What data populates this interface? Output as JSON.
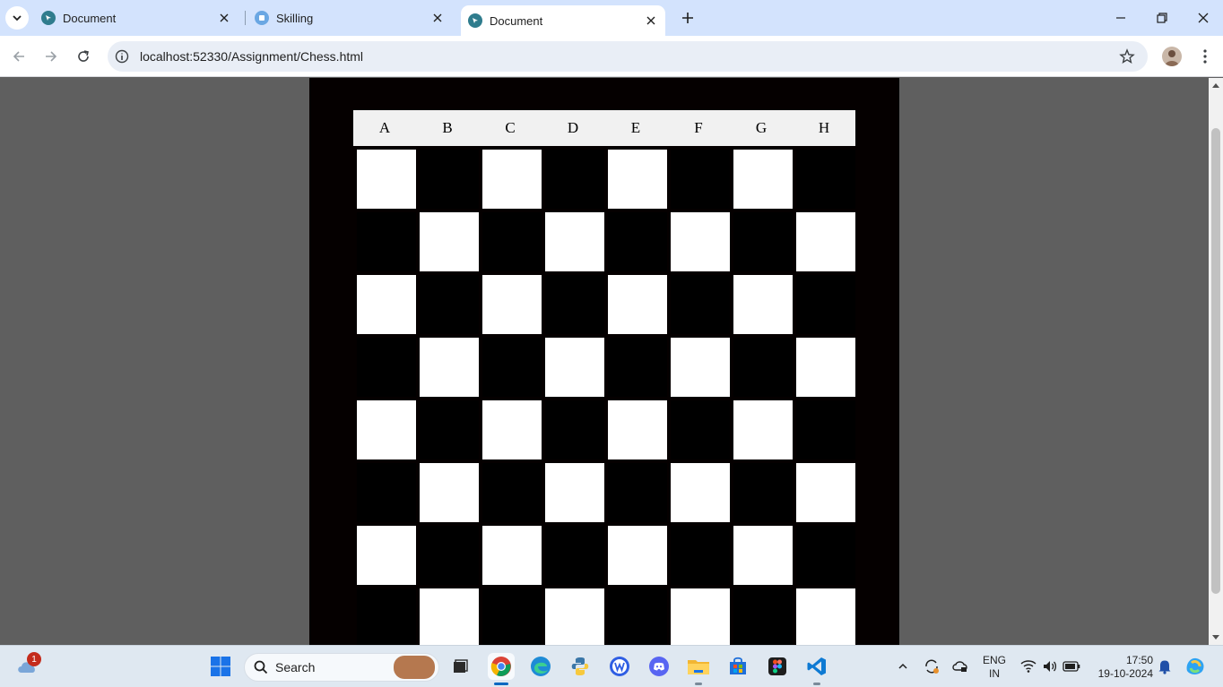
{
  "browser": {
    "tabs": [
      {
        "title": "Document",
        "active": false
      },
      {
        "title": "Skilling",
        "active": false
      },
      {
        "title": "Document",
        "active": true
      }
    ],
    "url": "localhost:52330/Assignment/Chess.html"
  },
  "chessboard": {
    "columns": [
      "A",
      "B",
      "C",
      "D",
      "E",
      "F",
      "G",
      "H"
    ],
    "rows_visible": 8,
    "top_left_square": "white",
    "colors": {
      "light": "#ffffff",
      "dark": "#000000",
      "frame": "#050000",
      "header_bg": "#f1f1f1",
      "page_bg": "#5f5f5f"
    }
  },
  "taskbar": {
    "search_label": "Search",
    "notification_count": "1",
    "language_line1": "ENG",
    "language_line2": "IN",
    "time": "17:50",
    "date": "19-10-2024",
    "pinned_apps": [
      "windows-start",
      "file-explorer-taskview",
      "chrome",
      "edge",
      "python",
      "wps",
      "discord",
      "file-explorer",
      "microsoft-store",
      "figma",
      "vscode"
    ]
  }
}
